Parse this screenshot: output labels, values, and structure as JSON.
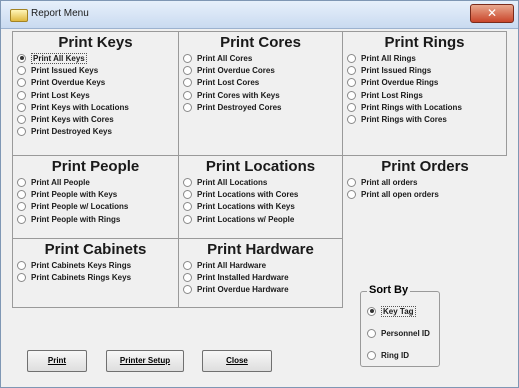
{
  "window": {
    "title": "Report Menu",
    "close_glyph": "✕"
  },
  "panels": {
    "keys": {
      "title": "Print Keys",
      "options": [
        "Print All Keys",
        "Print Issued Keys",
        "Print Overdue Keys",
        "Print Lost Keys",
        "Print Keys with Locations",
        "Print Keys with Cores",
        "Print Destroyed Keys"
      ]
    },
    "cores": {
      "title": "Print Cores",
      "options": [
        "Print All Cores",
        "Print Overdue Cores",
        "Print Lost Cores",
        "Print Cores with Keys",
        "Print Destroyed Cores"
      ]
    },
    "rings": {
      "title": "Print Rings",
      "options": [
        "Print All Rings",
        "Print Issued Rings",
        "Print Overdue Rings",
        "Print Lost Rings",
        "Print Rings with Locations",
        "Print Rings with Cores"
      ]
    },
    "people": {
      "title": "Print People",
      "options": [
        "Print All People",
        "Print People with Keys",
        "Print People w/ Locations",
        "Print People with Rings"
      ]
    },
    "locations": {
      "title": "Print Locations",
      "options": [
        "Print All Locations",
        "Print Locations with Cores",
        "Print Locations with Keys",
        "Print Locations w/ People"
      ]
    },
    "orders": {
      "title": "Print Orders",
      "options": [
        "Print all orders",
        "Print all open orders"
      ]
    },
    "cabinets": {
      "title": "Print Cabinets",
      "options": [
        "Print Cabinets Keys Rings",
        "Print Cabinets Rings Keys"
      ]
    },
    "hardware": {
      "title": "Print Hardware",
      "options": [
        "Print All Hardware",
        "Print Installed Hardware",
        "Print Overdue Hardware"
      ]
    }
  },
  "selected_report": "Print All Keys",
  "sort_by": {
    "title": "Sort By",
    "options": [
      "Key Tag",
      "Personnel ID",
      "Ring ID"
    ],
    "selected": "Key Tag"
  },
  "buttons": {
    "print": "Print",
    "setup": "Printer Setup",
    "close": "Close"
  }
}
